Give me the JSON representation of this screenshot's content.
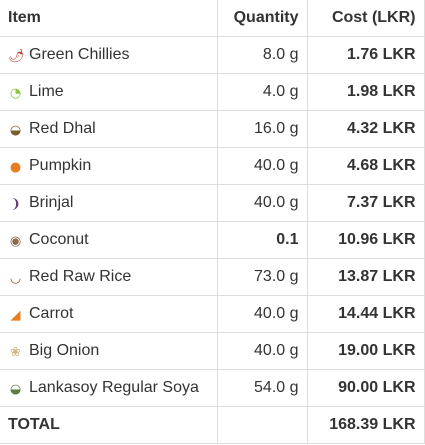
{
  "columns": {
    "item": "Item",
    "quantity": "Quantity",
    "cost": "Cost (LKR)"
  },
  "rows": [
    {
      "icon": "hot-pepper-icon",
      "glyph": "🌶",
      "color": "#c0392b",
      "name": "Green Chillies",
      "quantity": "8.0 g",
      "cost": "1.76 LKR"
    },
    {
      "icon": "lime-icon",
      "glyph": "◔",
      "color": "#8dc63f",
      "name": "Lime",
      "quantity": "4.0 g",
      "cost": "1.98 LKR"
    },
    {
      "icon": "bowl-icon",
      "glyph": "◒",
      "color": "#7a5c2e",
      "name": "Red Dhal",
      "quantity": "16.0 g",
      "cost": "4.32 LKR"
    },
    {
      "icon": "pumpkin-icon",
      "glyph": "●",
      "color": "#e67e22",
      "name": "Pumpkin",
      "quantity": "40.0 g",
      "cost": "4.68 LKR"
    },
    {
      "icon": "eggplant-icon",
      "glyph": "❩",
      "color": "#6a3d7a",
      "name": "Brinjal",
      "quantity": "40.0 g",
      "cost": "7.37 LKR"
    },
    {
      "icon": "coconut-icon",
      "glyph": "◉",
      "color": "#8b6b4a",
      "name": "Coconut",
      "quantity": "0.1",
      "cost": "10.96 LKR"
    },
    {
      "icon": "rice-bowl-icon",
      "glyph": "◡",
      "color": "#b03a2e",
      "name": "Red Raw Rice",
      "quantity": "73.0 g",
      "cost": "13.87 LKR"
    },
    {
      "icon": "carrot-icon",
      "glyph": "◢",
      "color": "#e67e22",
      "name": "Carrot",
      "quantity": "40.0 g",
      "cost": "14.44 LKR"
    },
    {
      "icon": "onion-icon",
      "glyph": "❀",
      "color": "#d4b483",
      "name": "Big Onion",
      "quantity": "40.0 g",
      "cost": "19.00 LKR"
    },
    {
      "icon": "bowl-icon",
      "glyph": "◒",
      "color": "#5d7a3a",
      "name": "Lankasoy Regular Soya",
      "quantity": "54.0 g",
      "cost": "90.00 LKR"
    }
  ],
  "total": {
    "label": "TOTAL",
    "value": "168.39 LKR"
  }
}
